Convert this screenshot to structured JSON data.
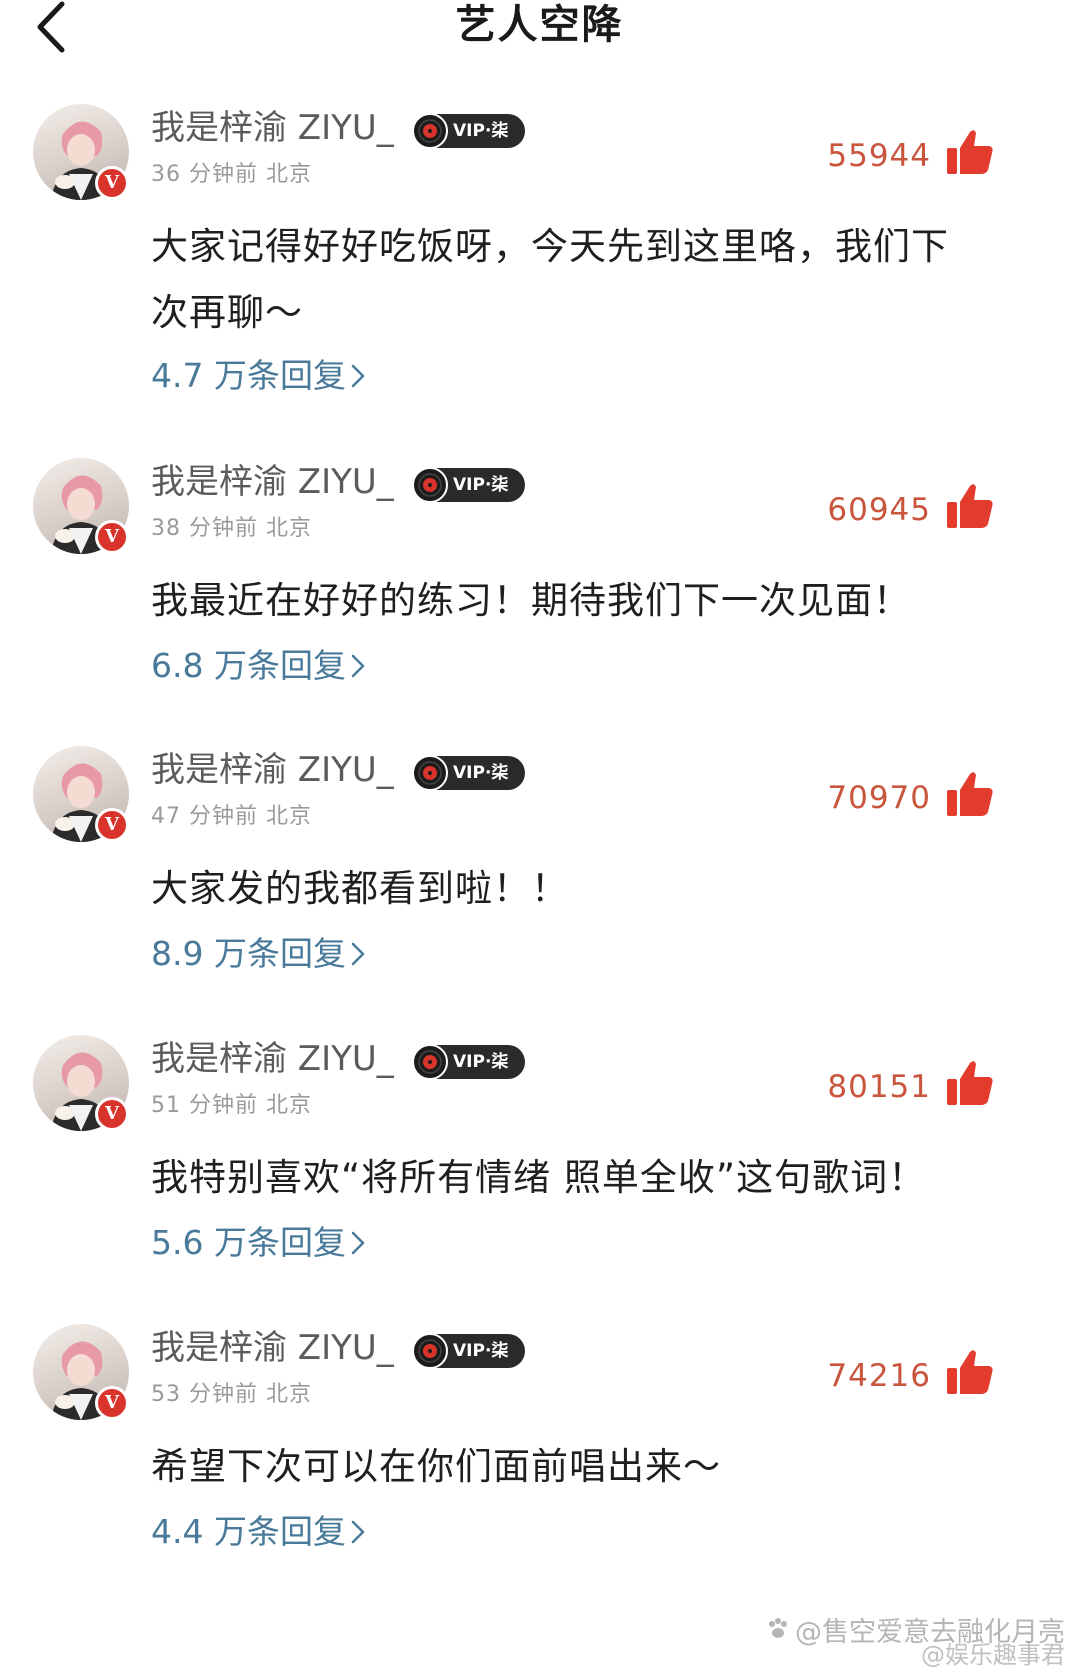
{
  "header": {
    "title": "艺人空降",
    "back_icon": "chevron-left-icon"
  },
  "colors": {
    "likes_text": "#c8553c",
    "like_icon": "#e33b2e",
    "replies_link": "#4a7a9a",
    "vip_badge_bg": "#2a2a2a",
    "verified_badge": "#d8342b"
  },
  "comments": [
    {
      "username": "我是梓渝 ZIYU_",
      "vip": "VIP·柒",
      "time": "36 分钟前",
      "location": "北京",
      "likes": "55944",
      "text": "大家记得好好吃饭呀，今天先到这里咯，我们下次再聊～",
      "replies": "4.7 万条回复"
    },
    {
      "username": "我是梓渝 ZIYU_",
      "vip": "VIP·柒",
      "time": "38 分钟前",
      "location": "北京",
      "likes": "60945",
      "text": "我最近在好好的练习！期待我们下一次见面！",
      "replies": "6.8 万条回复"
    },
    {
      "username": "我是梓渝 ZIYU_",
      "vip": "VIP·柒",
      "time": "47 分钟前",
      "location": "北京",
      "likes": "70970",
      "text": "大家发的我都看到啦！！",
      "replies": "8.9 万条回复"
    },
    {
      "username": "我是梓渝 ZIYU_",
      "vip": "VIP·柒",
      "time": "51 分钟前",
      "location": "北京",
      "likes": "80151",
      "text": "我特别喜欢“将所有情绪 照单全收”这句歌词！",
      "replies": "5.6 万条回复"
    },
    {
      "username": "我是梓渝 ZIYU_",
      "vip": "VIP·柒",
      "time": "53 分钟前",
      "location": "北京",
      "likes": "74216",
      "text": "希望下次可以在你们面前唱出来～",
      "replies": "4.4 万条回复"
    }
  ],
  "watermark": {
    "text": "@售空爱意去融化月亮",
    "text2": "@娱乐趣事君"
  }
}
